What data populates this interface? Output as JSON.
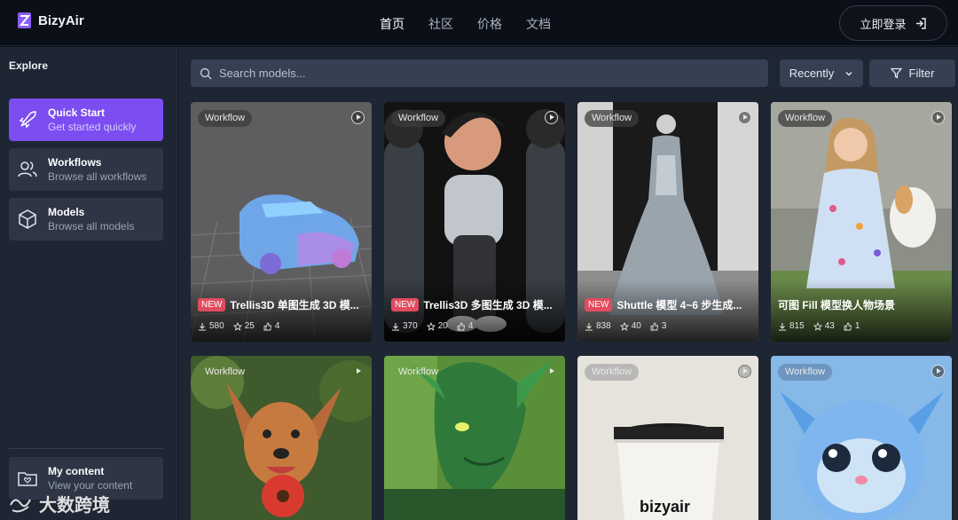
{
  "header": {
    "brand": "BizyAir",
    "nav": [
      "首页",
      "社区",
      "价格",
      "文档"
    ],
    "login_label": "立即登录"
  },
  "sidebar": {
    "section_title": "Explore",
    "items": [
      {
        "title": "Quick Start",
        "subtitle": "Get started quickly",
        "icon": "rocket-icon",
        "active": true
      },
      {
        "title": "Workflows",
        "subtitle": "Browse all workflows",
        "icon": "users-icon",
        "active": false
      },
      {
        "title": "Models",
        "subtitle": "Browse all models",
        "icon": "cube-icon",
        "active": false
      }
    ],
    "bottom_item": {
      "title": "My content",
      "subtitle": "View your content",
      "icon": "folder-heart-icon"
    }
  },
  "toolbar": {
    "search_placeholder": "Search models...",
    "sort_value": "Recently",
    "filter_label": "Filter"
  },
  "cards": [
    {
      "badge": "Workflow",
      "new": true,
      "new_label": "NEW",
      "title": "Trellis3D 单图生成 3D 模...",
      "downloads": "580",
      "stars": "25",
      "likes": "4"
    },
    {
      "badge": "Workflow",
      "new": true,
      "new_label": "NEW",
      "title": "Trellis3D 多图生成 3D 模...",
      "downloads": "370",
      "stars": "20",
      "likes": "4"
    },
    {
      "badge": "Workflow",
      "new": true,
      "new_label": "NEW",
      "title": "Shuttle 模型 4~6 步生成...",
      "downloads": "838",
      "stars": "40",
      "likes": "3"
    },
    {
      "badge": "Workflow",
      "new": false,
      "title": "可图 Fill 模型换人物场景",
      "downloads": "815",
      "stars": "43",
      "likes": "1"
    },
    {
      "badge": "Workflow"
    },
    {
      "badge": "Workflow"
    },
    {
      "badge": "Workflow",
      "image_text": "bizyair"
    },
    {
      "badge": "Workflow"
    }
  ],
  "watermark": "大数跨境",
  "colors": {
    "accent": "#7c4df0",
    "new_badge": "#e04c5f",
    "panel": "#1e2533",
    "control": "#354052"
  }
}
